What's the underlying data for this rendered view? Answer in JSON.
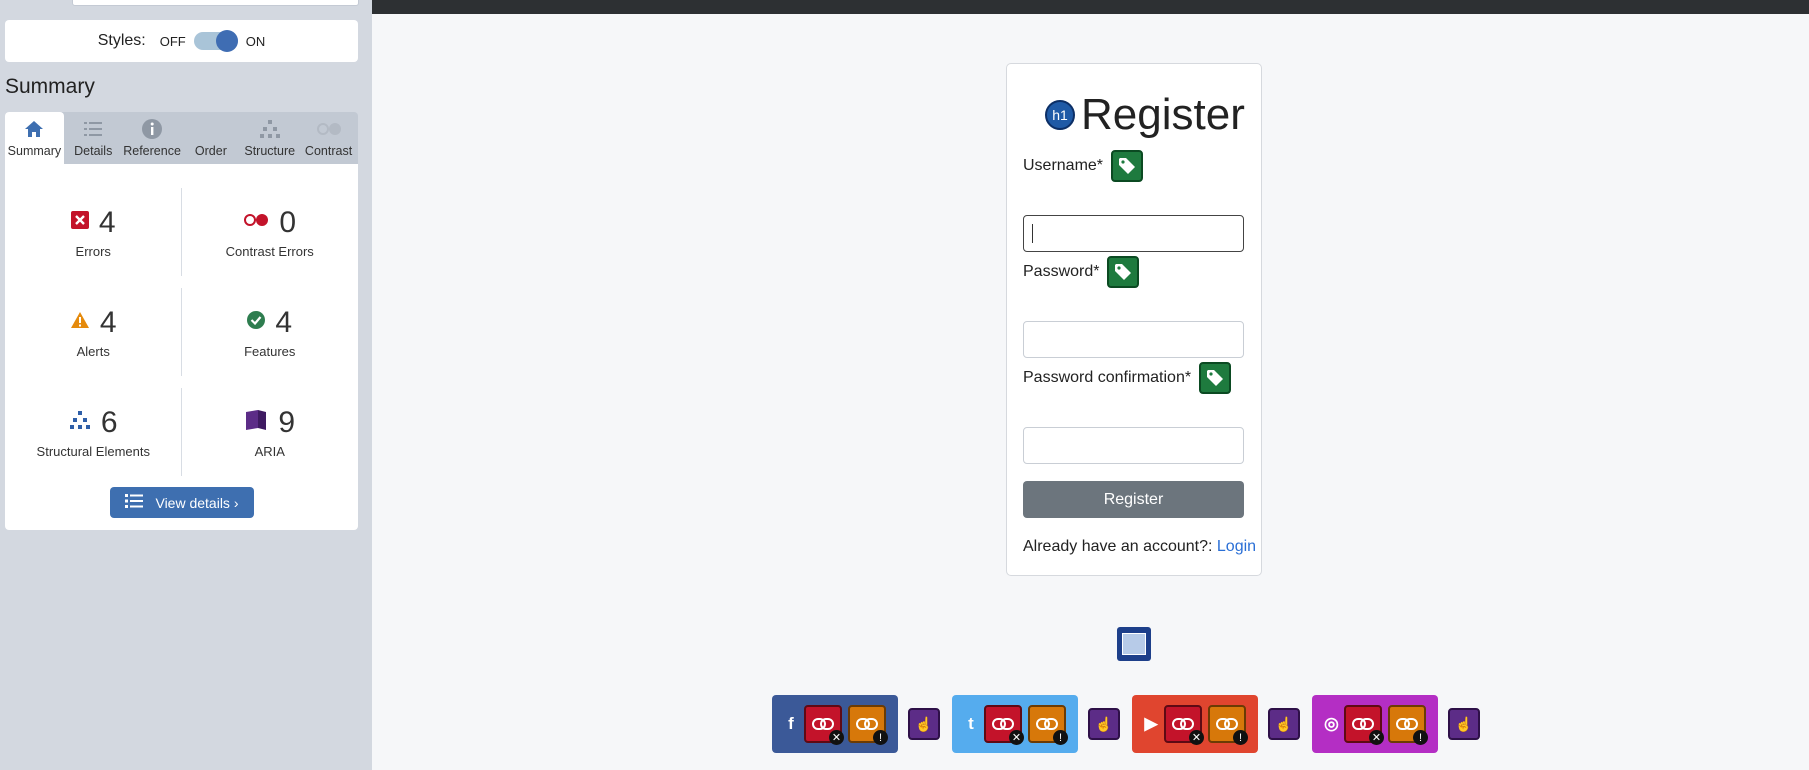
{
  "sidebar": {
    "styles_label": "Styles:",
    "toggle_off": "OFF",
    "toggle_on": "ON",
    "summary_heading": "Summary",
    "tabs": [
      {
        "label": "Summary",
        "icon": "home-icon"
      },
      {
        "label": "Details",
        "icon": "list-icon"
      },
      {
        "label": "Reference",
        "icon": "info-icon"
      },
      {
        "label": "Order",
        "icon": "order-icon"
      },
      {
        "label": "Structure",
        "icon": "structure-icon"
      },
      {
        "label": "Contrast",
        "icon": "contrast-icon"
      }
    ],
    "stats": [
      {
        "count": "4",
        "label": "Errors",
        "icon": "error-icon"
      },
      {
        "count": "0",
        "label": "Contrast Errors",
        "icon": "contrast-error-icon"
      },
      {
        "count": "4",
        "label": "Alerts",
        "icon": "alert-icon"
      },
      {
        "count": "4",
        "label": "Features",
        "icon": "feature-icon"
      },
      {
        "count": "6",
        "label": "Structural Elements",
        "icon": "structure-icon"
      },
      {
        "count": "9",
        "label": "ARIA",
        "icon": "aria-icon"
      }
    ],
    "view_details": "View details ›"
  },
  "form": {
    "h1_badge": "h1",
    "title": "Register",
    "username_label": "Username*",
    "password_label": "Password*",
    "password_confirmation_label": "Password confirmation*",
    "submit_label": "Register",
    "login_prompt": "Already have an account?: ",
    "login_link": "Login"
  },
  "colors": {
    "accent": "#3e6fb0",
    "error": "#c3132a",
    "alert": "#d7780a",
    "feature": "#1e7a3e",
    "aria": "#5c2c87",
    "facebook": "#3b5998",
    "twitter": "#55acee",
    "youtube": "#e0452f",
    "instagram": "#b42ec4"
  },
  "social": [
    {
      "name": "facebook",
      "glyph": "f"
    },
    {
      "name": "twitter",
      "glyph": "t"
    },
    {
      "name": "youtube",
      "glyph": "▶"
    },
    {
      "name": "instagram",
      "glyph": "◎"
    }
  ]
}
